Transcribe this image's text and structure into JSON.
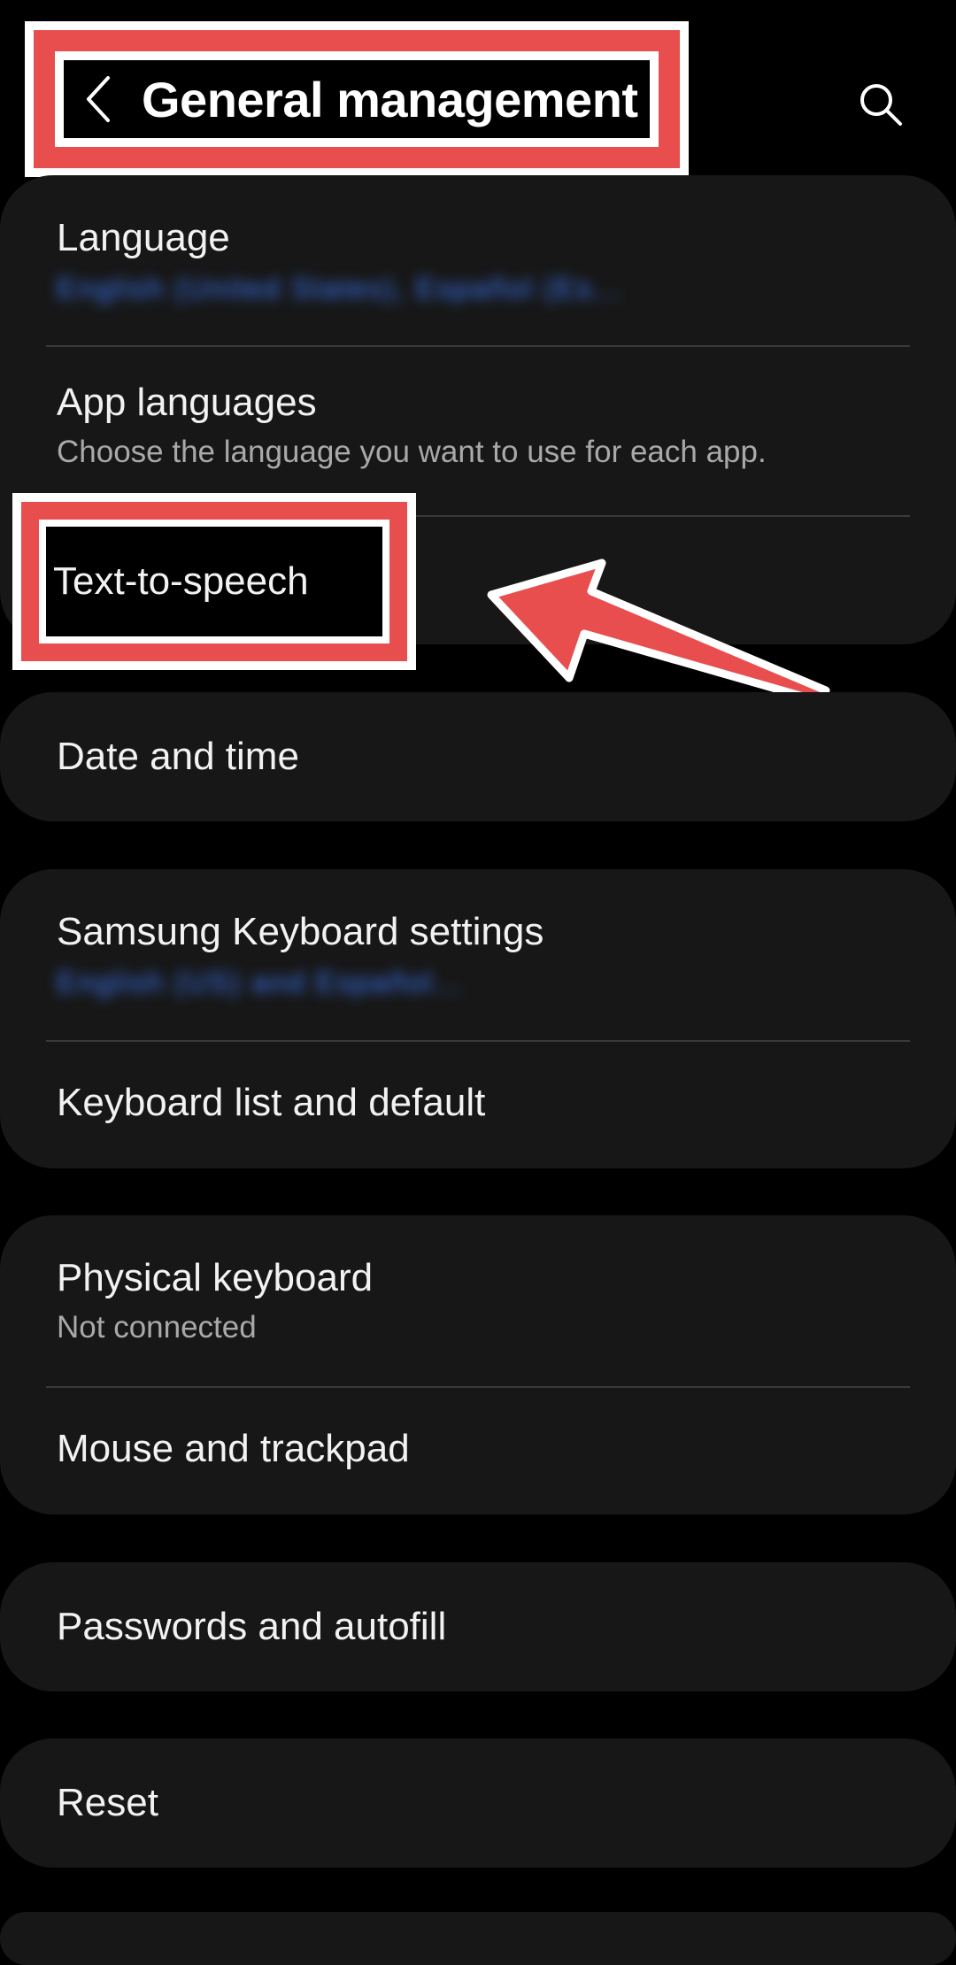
{
  "header": {
    "title": "General management",
    "back_icon": "back-chevron-icon",
    "search_icon": "search-icon"
  },
  "groups": {
    "language": {
      "language_title": "Language",
      "language_sub": "English (United States), Español (Es...",
      "app_languages_title": "App languages",
      "app_languages_sub": "Choose the language you want to use for each app.",
      "tts_title": "Text-to-speech"
    },
    "date": {
      "title": "Date and time"
    },
    "keyboard": {
      "samsung_title": "Samsung Keyboard settings",
      "samsung_sub": "English (US) and Español...",
      "list_title": "Keyboard list and default"
    },
    "physical": {
      "physical_title": "Physical keyboard",
      "physical_sub": "Not connected",
      "mouse_title": "Mouse and trackpad"
    },
    "passwords": {
      "title": "Passwords and autofill"
    },
    "reset": {
      "title": "Reset"
    }
  },
  "colors": {
    "background": "#000000",
    "card": "#171717",
    "highlight": "#e94e4e",
    "accent_link": "#3c7bff"
  }
}
